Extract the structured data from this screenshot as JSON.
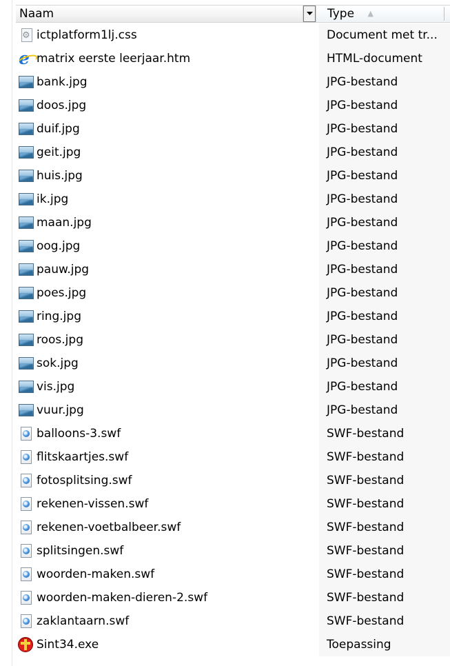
{
  "columns": {
    "name": "Naam",
    "type": "Type"
  },
  "files": [
    {
      "name": "ictplatform1lj.css",
      "type": "Document met tr...",
      "icon": "css-file-icon"
    },
    {
      "name": "matrix eerste leerjaar.htm",
      "type": "HTML-document",
      "icon": "ie-html-icon"
    },
    {
      "name": "bank.jpg",
      "type": "JPG-bestand",
      "icon": "image-file-icon"
    },
    {
      "name": "doos.jpg",
      "type": "JPG-bestand",
      "icon": "image-file-icon"
    },
    {
      "name": "duif.jpg",
      "type": "JPG-bestand",
      "icon": "image-file-icon"
    },
    {
      "name": "geit.jpg",
      "type": "JPG-bestand",
      "icon": "image-file-icon"
    },
    {
      "name": "huis.jpg",
      "type": "JPG-bestand",
      "icon": "image-file-icon"
    },
    {
      "name": "ik.jpg",
      "type": "JPG-bestand",
      "icon": "image-file-icon"
    },
    {
      "name": "maan.jpg",
      "type": "JPG-bestand",
      "icon": "image-file-icon"
    },
    {
      "name": "oog.jpg",
      "type": "JPG-bestand",
      "icon": "image-file-icon"
    },
    {
      "name": "pauw.jpg",
      "type": "JPG-bestand",
      "icon": "image-file-icon"
    },
    {
      "name": "poes.jpg",
      "type": "JPG-bestand",
      "icon": "image-file-icon"
    },
    {
      "name": "ring.jpg",
      "type": "JPG-bestand",
      "icon": "image-file-icon"
    },
    {
      "name": "roos.jpg",
      "type": "JPG-bestand",
      "icon": "image-file-icon"
    },
    {
      "name": "sok.jpg",
      "type": "JPG-bestand",
      "icon": "image-file-icon"
    },
    {
      "name": "vis.jpg",
      "type": "JPG-bestand",
      "icon": "image-file-icon"
    },
    {
      "name": "vuur.jpg",
      "type": "JPG-bestand",
      "icon": "image-file-icon"
    },
    {
      "name": "balloons-3.swf",
      "type": "SWF-bestand",
      "icon": "swf-file-icon"
    },
    {
      "name": "flitskaartjes.swf",
      "type": "SWF-bestand",
      "icon": "swf-file-icon"
    },
    {
      "name": "fotosplitsing.swf",
      "type": "SWF-bestand",
      "icon": "swf-file-icon"
    },
    {
      "name": "rekenen-vissen.swf",
      "type": "SWF-bestand",
      "icon": "swf-file-icon"
    },
    {
      "name": "rekenen-voetbalbeer.swf",
      "type": "SWF-bestand",
      "icon": "swf-file-icon"
    },
    {
      "name": "splitsingen.swf",
      "type": "SWF-bestand",
      "icon": "swf-file-icon"
    },
    {
      "name": "woorden-maken.swf",
      "type": "SWF-bestand",
      "icon": "swf-file-icon"
    },
    {
      "name": "woorden-maken-dieren-2.swf",
      "type": "SWF-bestand",
      "icon": "swf-file-icon"
    },
    {
      "name": "zaklantaarn.swf",
      "type": "SWF-bestand",
      "icon": "swf-file-icon"
    },
    {
      "name": "Sint34.exe",
      "type": "Toepassing",
      "icon": "exe-sint-icon"
    }
  ]
}
